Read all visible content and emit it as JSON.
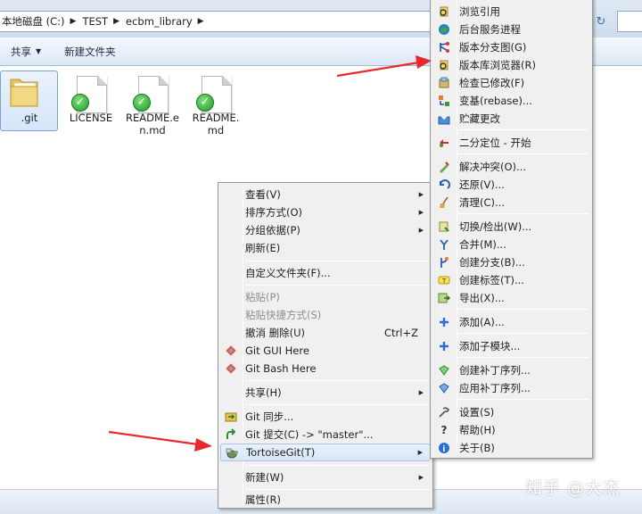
{
  "address": {
    "crumbs": [
      "本地磁盘 (C:)",
      "TEST",
      "ecbm_library"
    ]
  },
  "toolbar": {
    "share_label": "共享",
    "new_folder_label": "新建文件夹"
  },
  "files": [
    {
      "name": ".git",
      "icon": "folder-icon",
      "selected": true
    },
    {
      "name": "LICENSE",
      "icon": "document-ok-icon"
    },
    {
      "name": "README.e\nn.md",
      "icon": "document-ok-icon"
    },
    {
      "name": "README.\nmd",
      "icon": "document-ok-icon"
    }
  ],
  "context_menu": {
    "items": [
      {
        "label": "查看(V)",
        "submenu": true
      },
      {
        "label": "排序方式(O)",
        "submenu": true
      },
      {
        "label": "分组依据(P)",
        "submenu": true
      },
      {
        "label": "刷新(E)"
      },
      {
        "label": "自定义文件夹(F)..."
      },
      {
        "label": "粘贴(P)",
        "disabled": true
      },
      {
        "label": "粘贴快捷方式(S)",
        "disabled": true
      },
      {
        "label": "撤消 删除(U)",
        "accel": "Ctrl+Z"
      },
      {
        "label": "Git GUI Here",
        "icon": "git-gui-icon"
      },
      {
        "label": "Git Bash Here",
        "icon": "git-bash-icon"
      },
      {
        "label": "共享(H)",
        "submenu": true
      },
      {
        "label": "Git 同步...",
        "icon": "git-sync-icon"
      },
      {
        "label": "Git 提交(C) -> \"master\"...",
        "icon": "git-commit-icon"
      },
      {
        "label": "TortoiseGit(T)",
        "submenu": true,
        "icon": "tortoisegit-icon",
        "highlight": true
      },
      {
        "label": "新建(W)",
        "submenu": true
      },
      {
        "label": "属性(R)"
      }
    ]
  },
  "tortoise_menu": {
    "items": [
      {
        "label": "浏览引用",
        "icon": "browse-refs-icon"
      },
      {
        "label": "后台服务进程",
        "icon": "daemon-icon"
      },
      {
        "label": "版本分支图(G)",
        "icon": "revision-graph-icon"
      },
      {
        "label": "版本库浏览器(R)",
        "icon": "repo-browser-icon"
      },
      {
        "label": "检查已修改(F)",
        "icon": "check-modifications-icon"
      },
      {
        "label": "变基(rebase)...",
        "icon": "rebase-icon"
      },
      {
        "label": "贮藏更改",
        "icon": "stash-icon"
      },
      {
        "label": "二分定位 - 开始",
        "icon": "bisect-icon"
      },
      {
        "label": "解决冲突(O)...",
        "icon": "resolve-icon"
      },
      {
        "label": "还原(V)...",
        "icon": "revert-icon"
      },
      {
        "label": "清理(C)...",
        "icon": "cleanup-icon"
      },
      {
        "label": "切换/检出(W)...",
        "icon": "switch-icon"
      },
      {
        "label": "合并(M)...",
        "icon": "merge-icon"
      },
      {
        "label": "创建分支(B)...",
        "icon": "branch-icon"
      },
      {
        "label": "创建标签(T)...",
        "icon": "tag-icon"
      },
      {
        "label": "导出(X)...",
        "icon": "export-icon"
      },
      {
        "label": "添加(A)...",
        "icon": "add-icon"
      },
      {
        "label": "添加子模块...",
        "icon": "submodule-add-icon"
      },
      {
        "label": "创建补丁序列...",
        "icon": "create-patch-icon"
      },
      {
        "label": "应用补丁序列...",
        "icon": "apply-patch-icon"
      },
      {
        "label": "设置(S)",
        "icon": "settings-icon"
      },
      {
        "label": "帮助(H)",
        "icon": "help-icon"
      },
      {
        "label": "关于(B)",
        "icon": "about-icon"
      }
    ]
  },
  "watermark": "知乎 @大杰",
  "colors": {
    "menu_bg": "#f0f0f0",
    "highlight": "#d7e6f8",
    "arrow_red": "#e8282c",
    "check_green": "#1f9a2a"
  }
}
